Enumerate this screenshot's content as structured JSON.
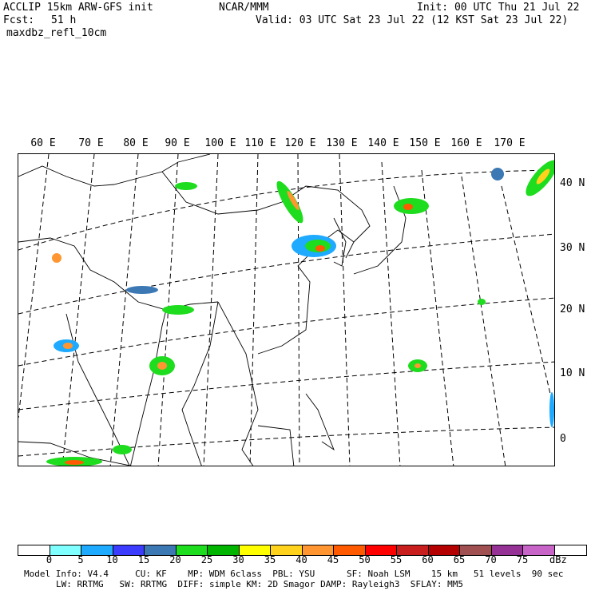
{
  "header": {
    "model": "ACCLIP 15km ARW-GFS init",
    "center": "NCAR/MMM",
    "init": "Init: 00 UTC Thu 21 Jul 22",
    "fcst_label": "Fcst:",
    "fcst_value": "51 h",
    "valid": "Valid: 03 UTC Sat 23 Jul 22 (12 KST Sat 23 Jul 22)",
    "field": "maxdbz_refl_10cm"
  },
  "map": {
    "lon_labels": [
      "60 E",
      "70 E",
      "80 E",
      "90 E",
      "100 E",
      "110 E",
      "120 E",
      "130 E",
      "140 E",
      "150 E",
      "160 E",
      "170 E"
    ],
    "lat_labels": [
      "40 N",
      "30 N",
      "20 N",
      "10 N",
      "0"
    ]
  },
  "legend": {
    "colors": [
      "#ffffff",
      "#7fffff",
      "#1eaaff",
      "#3c3cff",
      "#3c78b4",
      "#1edc1e",
      "#00b400",
      "#ffff00",
      "#ffd21e",
      "#ff9632",
      "#ff5a00",
      "#ff0000",
      "#c81e1e",
      "#b40000",
      "#a05050",
      "#963296",
      "#c864c8",
      "#ffffff"
    ],
    "ticks": [
      "0",
      "5",
      "10",
      "15",
      "20",
      "25",
      "30",
      "35",
      "40",
      "45",
      "50",
      "55",
      "60",
      "65",
      "70",
      "75"
    ],
    "unit": "dBz"
  },
  "footer": {
    "line1": "Model Info: V4.4     CU: KF    MP: WDM 6class  PBL: YSU      SF: Noah LSM    15 km   51 levels  90 sec",
    "line2": "LW: RRTMG   SW: RRTMG  DIFF: simple KM: 2D Smagor DAMP: Rayleigh3  SFLAY: MM5"
  }
}
